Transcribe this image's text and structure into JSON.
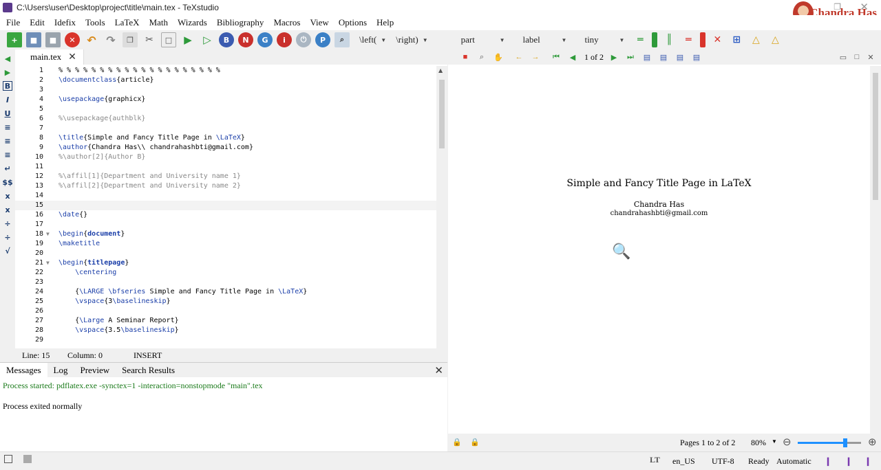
{
  "window": {
    "title": "C:\\Users\\user\\Desktop\\project\\title\\main.tex - TeXstudio",
    "brand": "Chandra Has"
  },
  "menu": [
    "File",
    "Edit",
    "Idefix",
    "Tools",
    "LaTeX",
    "Math",
    "Wizards",
    "Bibliography",
    "Macros",
    "View",
    "Options",
    "Help"
  ],
  "toolbar": {
    "left_combo": "\\left(",
    "right_combo": "\\right)",
    "part_combo": "part",
    "label_combo": "label",
    "size_combo": "tiny"
  },
  "editor": {
    "tab_label": "main.tex",
    "lines": [
      "% % % % % % % % % % % % % % % % % % % %",
      "\\documentclass{article}",
      "",
      "\\usepackage{graphicx}",
      "",
      "%\\usepackage{authblk}",
      "",
      "\\title{Simple and Fancy Title Page in \\LaTeX}",
      "\\author{Chandra Has\\\\ chandrahashbti@gmail.com}",
      "%\\author[2]{Author B}",
      "",
      "%\\affil[1]{Department and University name 1}",
      "%\\affil[2]{Department and University name 2}",
      "",
      "",
      "\\date{}",
      "",
      "\\begin{document}",
      "\\maketitle",
      "",
      "\\begin{titlepage}",
      "    \\centering",
      "",
      "    {\\LARGE \\bfseries Simple and Fancy Title Page in \\LaTeX}",
      "    \\vspace{3\\baselineskip}",
      "",
      "    {\\Large A Seminar Report}",
      "    \\vspace{3.5\\baselineskip}",
      ""
    ],
    "current_line": 15
  },
  "status": {
    "line": "Line: 15",
    "column": "Column: 0",
    "mode": "INSERT"
  },
  "messages": {
    "tabs": [
      "Messages",
      "Log",
      "Preview",
      "Search Results"
    ],
    "process_started": "Process started: pdflatex.exe -synctex=1 -interaction=nonstopmode \"main\".tex",
    "process_exit": "Process exited normally"
  },
  "pdf": {
    "page_indicator": "1 of 2",
    "doc_title": "Simple and Fancy Title Page in LaTeX",
    "author": "Chandra Has",
    "email": "chandrahashbti@gmail.com",
    "pages_label": "Pages 1 to 2 of 2",
    "zoom": "80%",
    "zoom_fraction": 0.75
  },
  "statusbar": {
    "language": "en_US",
    "encoding": "UTF-8",
    "ready": "Ready",
    "automatic": "Automatic"
  },
  "colors": {
    "command": "#1a3ea8",
    "comment": "#888888",
    "messages_green": "#1a7a1a",
    "brand_red": "#c0392b"
  }
}
